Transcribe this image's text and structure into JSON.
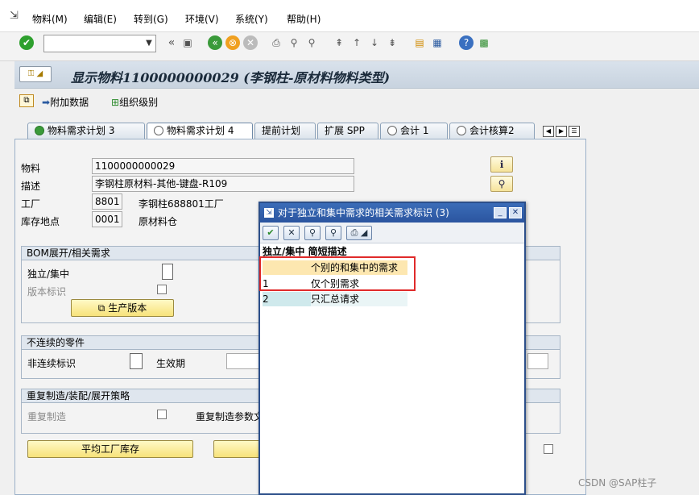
{
  "menubar": {
    "items": [
      "物料(M)",
      "编辑(E)",
      "转到(G)",
      "环境(V)",
      "系统(Y)",
      "帮助(H)"
    ]
  },
  "toolbar": {
    "command_field": "",
    "back_glyph": "«"
  },
  "title": "显示物料1100000000029 (李钢柱-原材料物料类型)",
  "app_toolbar": {
    "additional_data": "附加数据",
    "org_levels": "组织级别"
  },
  "tabs": [
    "物料需求计划 3",
    "物料需求计划 4",
    "提前计划",
    "扩展 SPP",
    "会计 1",
    "会计核算2"
  ],
  "header": {
    "material_label": "物料",
    "material_value": "1100000000029",
    "desc_label": "描述",
    "desc_value": "李钢柱原材料-其他-键盘-R109",
    "plant_label": "工厂",
    "plant_value": "8801",
    "plant_name": "李钢柱688801工厂",
    "storage_label": "库存地点",
    "storage_value": "0001",
    "storage_name": "原材料仓"
  },
  "bom_group": {
    "title": "BOM展开/相关需求",
    "ind_coll_label": "独立/集中",
    "version_label": "版本标识",
    "prod_version_button": "生产版本"
  },
  "discont_group": {
    "title": "不连续的零件",
    "discont_label": "非连续标识",
    "eff_label": "生效期"
  },
  "rep_group": {
    "title": "重复制造/装配/展开策略",
    "rep_label": "重复制造",
    "rep_profile_label": "重复制造参数文"
  },
  "bottom_button": "平均工厂库存",
  "dialog": {
    "title": "对于独立和集中需求的相关需求标识 (3)",
    "col1": "独立/集中",
    "col2": "简短描述",
    "rows": [
      {
        "code": "",
        "desc": "个别的和集中的需求"
      },
      {
        "code": "1",
        "desc": "仅个别需求"
      },
      {
        "code": "2",
        "desc": "只汇总请求"
      }
    ]
  },
  "watermark": "CSDN @SAP柱子"
}
